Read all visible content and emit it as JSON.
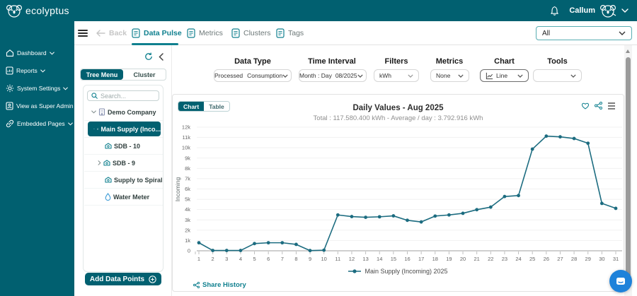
{
  "topbar": {
    "brand": "ecolyptus",
    "user": "Callum"
  },
  "sidebar": {
    "items": [
      {
        "label": "Dashboard"
      },
      {
        "label": "Reports"
      },
      {
        "label": "System Settings"
      },
      {
        "label": "View as Super Admin"
      },
      {
        "label": "Embedded Pages"
      }
    ]
  },
  "tabsbar": {
    "back_label": "Back",
    "tabs": [
      {
        "label": "Data Pulse"
      },
      {
        "label": "Metrics"
      },
      {
        "label": "Clusters"
      },
      {
        "label": "Tags"
      }
    ],
    "scope_select_value": "All"
  },
  "tree_panel": {
    "toggle_left": "Tree Menu",
    "toggle_right": "Cluster",
    "search_placeholder": "Search...",
    "nodes": [
      {
        "label": "Demo Company"
      },
      {
        "label": "Main Supply (Inco..."
      },
      {
        "label": "SDB - 10"
      },
      {
        "label": "SDB - 9"
      },
      {
        "label": "Supply to Spiral"
      },
      {
        "label": "Water Meter"
      }
    ],
    "add_button_label": "Add Data Points"
  },
  "filter_bar": {
    "data_type_label": "Data Type",
    "data_type_value_1": "Processed",
    "data_type_value_2": "Consumption",
    "time_interval_label": "Time Interval",
    "time_interval_value_1": "Month : Day",
    "time_interval_value_2": "08/2025",
    "filters_label": "Filters",
    "filters_value": "kWh",
    "metrics_label": "Metrics",
    "metrics_value": "None",
    "chart_label": "Chart",
    "chart_value": "Line",
    "tools_label": "Tools",
    "tools_value": ""
  },
  "chart_card": {
    "view_chart": "Chart",
    "view_table": "Table",
    "share_history": "Share History"
  },
  "chart_data": {
    "type": "line",
    "title": "Daily Values - Aug 2025",
    "subtitle": "Total : 117.580.400 kWh - Average / day : 3.792.916 kWh",
    "x": [
      1,
      2,
      3,
      4,
      5,
      6,
      7,
      8,
      9,
      10,
      11,
      12,
      13,
      14,
      15,
      16,
      17,
      18,
      19,
      20,
      21,
      22,
      23,
      24,
      25,
      26,
      27,
      28,
      29,
      30,
      31
    ],
    "series": [
      {
        "name": "Main Supply (Incoming) 2025",
        "color": "#1c6c80",
        "values": [
          780,
          30,
          30,
          30,
          700,
          780,
          780,
          620,
          20,
          60,
          3480,
          3320,
          3250,
          3300,
          3390,
          2960,
          2800,
          3370,
          3480,
          3640,
          3990,
          4240,
          5270,
          5360,
          9870,
          11130,
          11060,
          10900,
          10440,
          4600,
          4120
        ]
      }
    ],
    "ylabel": "Incoming",
    "ylim": [
      0,
      12000
    ],
    "y_ticks": [
      "0",
      "1k",
      "2k",
      "3k",
      "4k",
      "5k",
      "6k",
      "7k",
      "8k",
      "9k",
      "10k",
      "11k",
      "12k"
    ],
    "grid": "horizontal",
    "legend_position": "bottom"
  }
}
